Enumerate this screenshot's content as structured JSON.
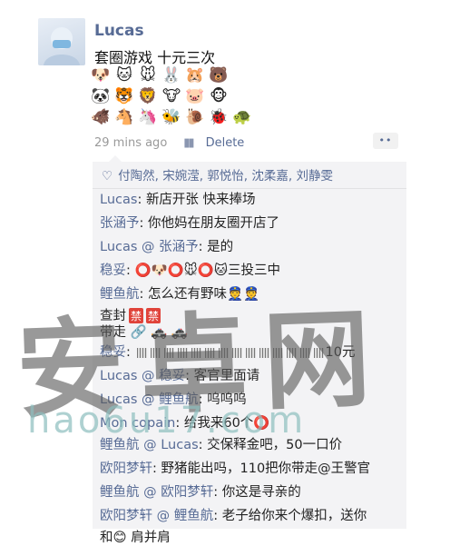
{
  "post": {
    "username": "Lucas",
    "text": "套圈游戏 十元三次",
    "emoji_rows": [
      [
        "🐶",
        "🐱",
        "🐭",
        "🐰",
        "🐹",
        "🐻"
      ],
      [
        "🐼",
        "🐯",
        "🦁",
        "🐮",
        "🐷",
        "🐵"
      ],
      [
        "🐗",
        "🐴",
        "🦄",
        "🐝",
        "🐌",
        "🐞",
        "🐢"
      ]
    ],
    "time": "29 mins ago",
    "delete_label": "Delete",
    "more_label": "••"
  },
  "likes": {
    "names": "付陶然, 宋婉滢, 郭悦怡, 沈柔嘉, 刘静雯"
  },
  "comments": [
    {
      "user": "Lucas",
      "reply_to": "",
      "text": "新店开张 快来捧场"
    },
    {
      "user": "张涵予",
      "reply_to": "",
      "text": "你他妈在朋友圈开店了"
    },
    {
      "user": "Lucas",
      "reply_to": "张涵予",
      "text": "是的"
    },
    {
      "user": "稳妥",
      "reply_to": "",
      "text": "⭕🐶⭕🐭⭕🐱三投三中"
    },
    {
      "user": "鲤鱼航",
      "reply_to": "",
      "text": "怎么还有野味👮👮"
    },
    {
      "user": "",
      "reply_to": "",
      "text": "查封"
    },
    {
      "user": "",
      "reply_to": "",
      "text": "带走 🔗 🚓 🚓"
    },
    {
      "user": "稳妥",
      "reply_to": "",
      "text": "10元"
    },
    {
      "user": "Lucas",
      "reply_to": "稳妥",
      "text": "客官里面请"
    },
    {
      "user": "Lucas",
      "reply_to": "鲤鱼航",
      "text": "呜呜呜"
    },
    {
      "user": "Mon copain",
      "reply_to": "",
      "text": "给我来60个⭕"
    },
    {
      "user": "鲤鱼航",
      "reply_to": "Lucas",
      "text": "交保释金吧，50一口价"
    },
    {
      "user": "欧阳梦轩",
      "reply_to": "",
      "text": "野猪能出吗，110把你带走@王警官"
    },
    {
      "user": "鲤鱼航",
      "reply_to": "欧阳梦轩",
      "text": "你这是寻亲的"
    },
    {
      "user": "欧阳梦轩",
      "reply_to": "鲤鱼航",
      "text": "老子给你来个爆扣，送你"
    },
    {
      "user": "",
      "reply_to": "",
      "text": "和😊 肩并肩"
    }
  ],
  "tags": {
    "ban": "禁"
  },
  "watermark": {
    "line1": "安卓网",
    "line2": "hao6u17.com"
  },
  "colors": {
    "link": "#576b95",
    "bg": "#f3f3f5"
  }
}
